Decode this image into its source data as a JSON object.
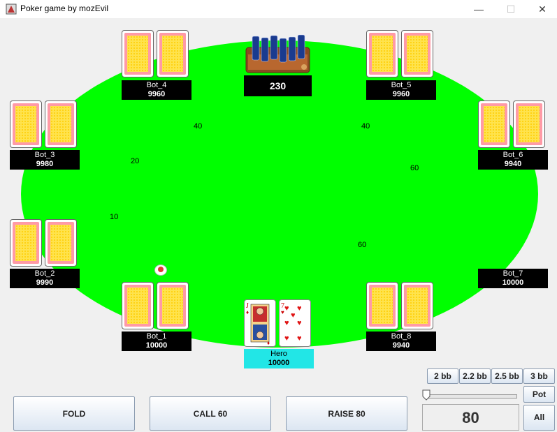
{
  "window": {
    "title": "Poker game by mozEvil",
    "minimize": "—",
    "maximize": "☐",
    "close": "✕"
  },
  "pot": {
    "amount": "230"
  },
  "players": {
    "bot_1": {
      "name": "Bot_1",
      "stack": "10000"
    },
    "bot_2": {
      "name": "Bot_2",
      "stack": "9990"
    },
    "bot_3": {
      "name": "Bot_3",
      "stack": "9980"
    },
    "bot_4": {
      "name": "Bot_4",
      "stack": "9960"
    },
    "bot_5": {
      "name": "Bot_5",
      "stack": "9960"
    },
    "bot_6": {
      "name": "Bot_6",
      "stack": "9940"
    },
    "bot_7": {
      "name": "Bot_7",
      "stack": "10000"
    },
    "bot_8": {
      "name": "Bot_8",
      "stack": "9940"
    },
    "hero": {
      "name": "Hero",
      "stack": "10000"
    }
  },
  "bets": {
    "bot_4": "40",
    "bot_5": "40",
    "bot_3": "20",
    "bot_6": "60",
    "bot_2": "10",
    "bot_8": "60"
  },
  "hero_cards": [
    {
      "rank": "J",
      "suit": "♦",
      "icon": "jack-of-diamonds-card"
    },
    {
      "rank": "7",
      "suit": "♥",
      "icon": "seven-of-hearts-card"
    }
  ],
  "controls": {
    "fold": "FOLD",
    "call": "CALL 60",
    "raise": "RAISE 80",
    "presets": [
      "2 bb",
      "2.2 bb",
      "2.5 bb",
      "3 bb"
    ],
    "pot": "Pot",
    "all": "All",
    "raise_amount": "80"
  },
  "colors": {
    "felt": "#00ff00",
    "hero_plate": "#22e6e6",
    "nameplate": "#000000"
  }
}
